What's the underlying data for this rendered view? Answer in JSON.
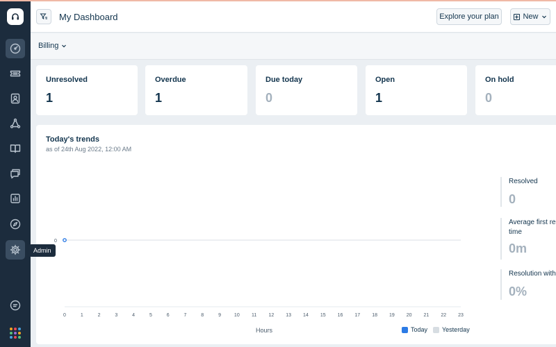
{
  "header": {
    "title": "My Dashboard",
    "explore_label": "Explore your plan",
    "new_label": "New"
  },
  "subheader": {
    "group_label": "Billing"
  },
  "sidebar": {
    "tooltip": "Admin",
    "items": [
      "dashboard-icon",
      "tickets-icon",
      "contacts-icon",
      "social-icon",
      "solutions-icon",
      "forums-icon",
      "reports-icon",
      "compass-icon",
      "admin-gear-icon",
      "chat-icon"
    ]
  },
  "stats": [
    {
      "label": "Unresolved",
      "value": "1"
    },
    {
      "label": "Overdue",
      "value": "1"
    },
    {
      "label": "Due today",
      "value": "0"
    },
    {
      "label": "Open",
      "value": "1"
    },
    {
      "label": "On hold",
      "value": "0"
    }
  ],
  "trends": {
    "title": "Today's trends",
    "subtitle": "as of 24th Aug 2022, 12:00 AM",
    "metrics": [
      {
        "label": "Resolved",
        "value": "0"
      },
      {
        "label": "Average first re",
        "label2": "time",
        "value": "0m"
      },
      {
        "label": "Resolution with",
        "value": "0%"
      }
    ]
  },
  "colors": {
    "sidebar": "#1c2c3d",
    "today": "#2c7be5",
    "yesterday": "#d7dde2",
    "zero_value": "#a4b1bd"
  },
  "chart_data": {
    "type": "line",
    "xlabel": "Hours",
    "ylabel": "",
    "x": [
      0,
      1,
      2,
      3,
      4,
      5,
      6,
      7,
      8,
      9,
      10,
      11,
      12,
      13,
      14,
      15,
      16,
      17,
      18,
      19,
      20,
      21,
      22,
      23
    ],
    "y_ticks": [
      "0"
    ],
    "series": [
      {
        "name": "Today",
        "values": [
          0
        ]
      },
      {
        "name": "Yesterday",
        "values": []
      }
    ]
  }
}
